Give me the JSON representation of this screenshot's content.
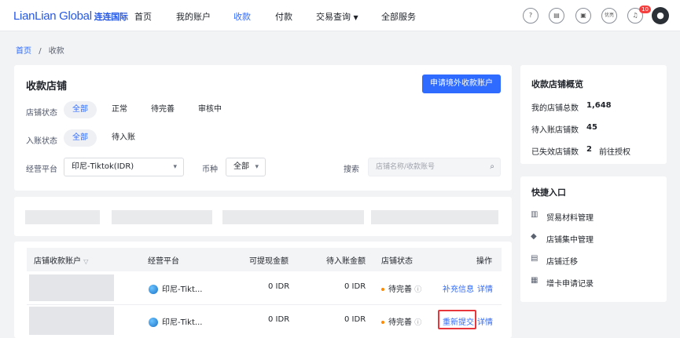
{
  "header": {
    "logo": "LianLian Global",
    "logo_cn": "连连国际",
    "nav": [
      "首页",
      "我的账户",
      "收款",
      "付款",
      "交易查询",
      "全部服务"
    ],
    "lang_label": "优亮",
    "notification_count": "10",
    "accent_color": "#2f6bff"
  },
  "breadcrumb": {
    "home": "首页",
    "sep": "/",
    "current": "收款"
  },
  "stores": {
    "title": "收款店铺",
    "apply_button": "申请境外收款账户",
    "status_label": "店铺状态",
    "status_options": [
      "全部",
      "正常",
      "待完善",
      "审核中"
    ],
    "entry_label": "入账状态",
    "entry_options": [
      "全部",
      "待入账"
    ],
    "platform_label": "经营平台",
    "platform_value": "印尼-Tiktok(IDR)",
    "currency_label": "币种",
    "currency_value": "全部",
    "search_label": "搜索",
    "search_placeholder": "店铺名称/收款账号"
  },
  "table": {
    "headers": [
      "店铺收款账户",
      "经营平台",
      "可提现金额",
      "待入账金额",
      "店铺状态",
      "操作"
    ],
    "rows": [
      {
        "platform": "印尼-Tikt...",
        "withdrawable": "0 IDR",
        "pending": "0 IDR",
        "status": "待完善",
        "action1": "补充信息",
        "action2": "详情"
      },
      {
        "platform": "印尼-Tikt...",
        "withdrawable": "0 IDR",
        "pending": "0 IDR",
        "status": "待完善",
        "action1": "重新提交",
        "action2": "详情"
      }
    ]
  },
  "overview": {
    "title": "收款店铺概览",
    "total_label": "我的店铺总数",
    "total_value": "1,648",
    "pending_label": "待入账店铺数",
    "pending_value": "45",
    "expired_label": "已失效店铺数",
    "expired_value": "2",
    "authorize_link": "前往授权"
  },
  "quick": {
    "title": "快捷入口",
    "items": [
      "贸易材料管理",
      "店铺集中管理",
      "店铺迁移",
      "增卡申请记录"
    ]
  }
}
